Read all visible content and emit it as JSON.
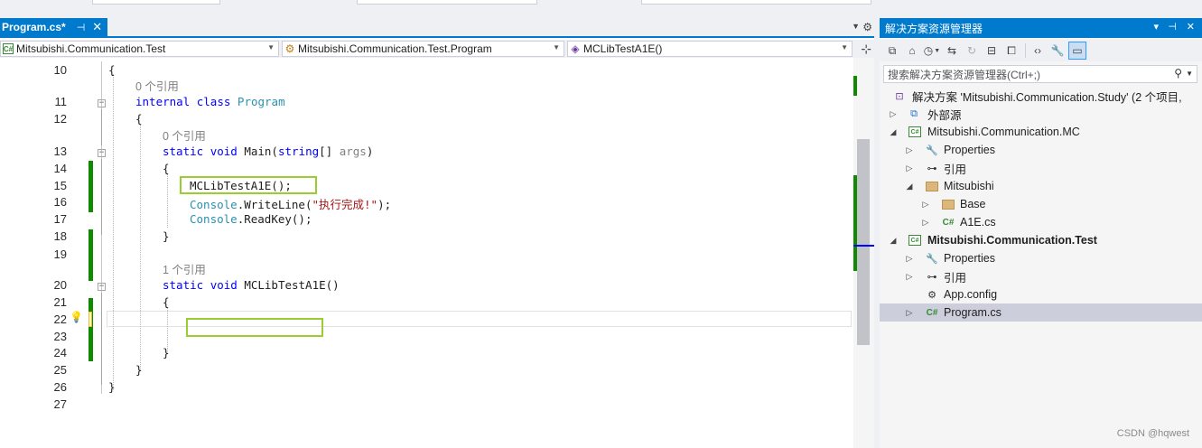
{
  "editor": {
    "tab": {
      "name": "Program.cs*",
      "pin_icon": "pin-icon",
      "close_icon": "close-icon"
    },
    "nav": {
      "project": "Mitsubishi.Communication.Test",
      "type": "Mitsubishi.Communication.Test.Program",
      "member": "MCLibTestA1E()"
    },
    "lines": [
      {
        "n": "10"
      },
      {
        "n": "11"
      },
      {
        "n": "12"
      },
      {
        "n": "13"
      },
      {
        "n": "14"
      },
      {
        "n": "15"
      },
      {
        "n": "16"
      },
      {
        "n": "17"
      },
      {
        "n": "18"
      },
      {
        "n": "19"
      },
      {
        "n": "20"
      },
      {
        "n": "21"
      },
      {
        "n": "22"
      },
      {
        "n": "23"
      },
      {
        "n": "24"
      },
      {
        "n": "25"
      },
      {
        "n": "26"
      },
      {
        "n": "27"
      }
    ],
    "code": {
      "brace_open_ns": "{",
      "lens_program": "0 个引用",
      "kw_internal": "internal",
      "kw_class": "class",
      "class_name": "Program",
      "brace_open_class": "{",
      "lens_main": "0 个引用",
      "kw_static": "static",
      "kw_void": "void",
      "main_name": "Main(",
      "kw_string": "string",
      "main_params": "[] ",
      "main_arg": "args",
      "main_close": ")",
      "brace_open_main": "{",
      "call_a1e": "MCLibTestA1E();",
      "console1": "Console",
      "writeline": ".WriteLine(",
      "string_done": "\"执行完成!\"",
      "writeline_end": ");",
      "console2": "Console",
      "readkey": ".ReadKey();",
      "brace_close_main": "}",
      "lens_a1e": "1 个引用",
      "kw_static2": "static",
      "kw_void2": "void",
      "a1e_decl": "MCLibTestA1E()",
      "brace_open_a1e": "{",
      "brace_close_a1e": "}",
      "brace_close_class": "}",
      "brace_close_ns": "}"
    }
  },
  "solution_explorer": {
    "title": "解决方案资源管理器",
    "search_placeholder": "搜索解决方案资源管理器(Ctrl+;)",
    "tree": [
      {
        "label": "解决方案 'Mitsubishi.Communication.Study' (2 个项目,",
        "icon": "solution-icon"
      },
      {
        "label": "外部源",
        "icon": "external-sources-icon"
      },
      {
        "label": "Mitsubishi.Communication.MC",
        "icon": "csharp-project-icon"
      },
      {
        "label": "Properties",
        "icon": "wrench-icon"
      },
      {
        "label": "引用",
        "icon": "references-icon"
      },
      {
        "label": "Mitsubishi",
        "icon": "folder-icon"
      },
      {
        "label": "Base",
        "icon": "folder-icon"
      },
      {
        "label": "A1E.cs",
        "icon": "csharp-file-icon"
      },
      {
        "label": "Mitsubishi.Communication.Test",
        "icon": "csharp-project-icon"
      },
      {
        "label": "Properties",
        "icon": "wrench-icon"
      },
      {
        "label": "引用",
        "icon": "references-icon"
      },
      {
        "label": "App.config",
        "icon": "config-file-icon"
      },
      {
        "label": "Program.cs",
        "icon": "csharp-file-icon"
      }
    ]
  },
  "watermark": "CSDN @hqwest"
}
